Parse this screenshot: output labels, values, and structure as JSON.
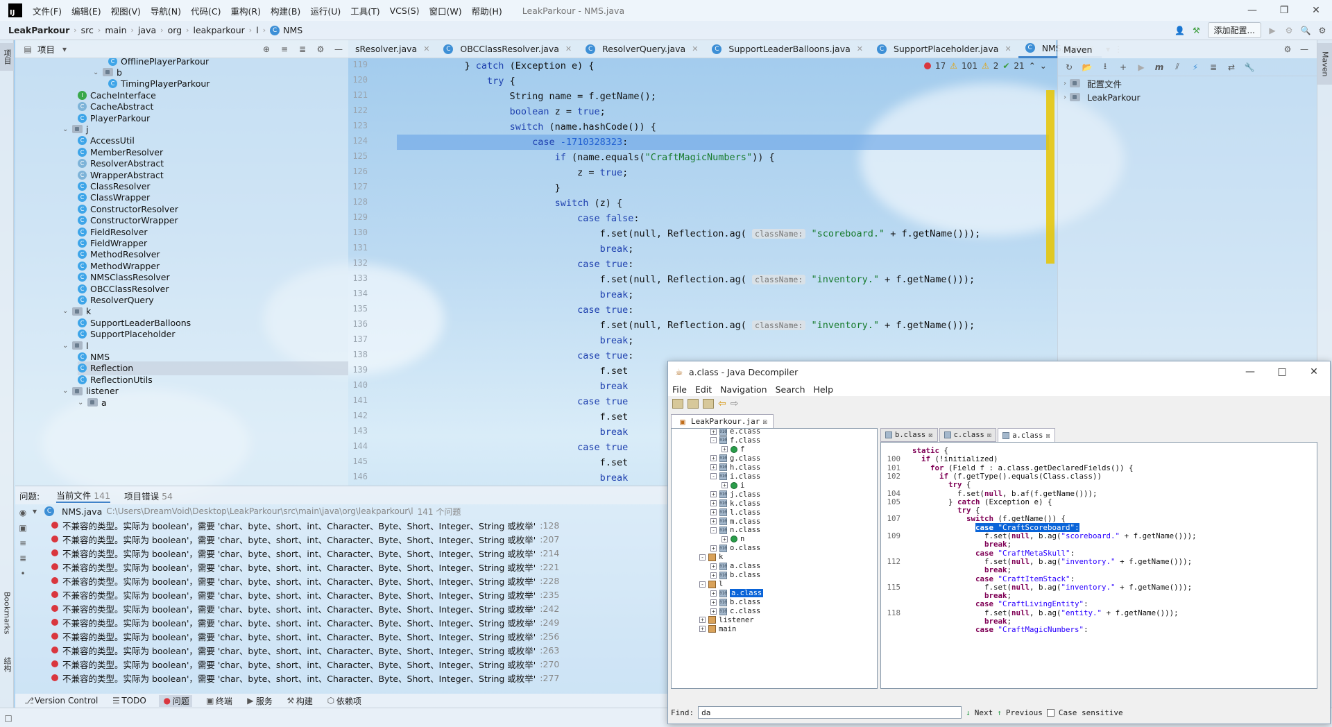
{
  "titlebar": {
    "menus": [
      "文件(F)",
      "编辑(E)",
      "视图(V)",
      "导航(N)",
      "代码(C)",
      "重构(R)",
      "构建(B)",
      "运行(U)",
      "工具(T)",
      "VCS(S)",
      "窗口(W)",
      "帮助(H)"
    ],
    "title": "LeakParkour - NMS.java"
  },
  "navbar": {
    "breadcrumbs": [
      "LeakParkour",
      "src",
      "main",
      "java",
      "org",
      "leakparkour",
      "l"
    ],
    "current": "NMS",
    "run_config": "添加配置..."
  },
  "left_stripe": {
    "project": "项目",
    "bookmarks": "Bookmarks",
    "structure": "结构"
  },
  "right_stripe": {
    "maven": "Maven"
  },
  "project_panel": {
    "title": "项目",
    "rows": [
      {
        "label": "OfflinePlayerParkour",
        "kind": "class"
      },
      {
        "label": "b",
        "kind": "package"
      },
      {
        "label": "TimingPlayerParkour",
        "kind": "class"
      },
      {
        "label": "CacheInterface",
        "kind": "interface"
      },
      {
        "label": "CacheAbstract",
        "kind": "abstract"
      },
      {
        "label": "PlayerParkour",
        "kind": "class"
      },
      {
        "label": "j",
        "kind": "package"
      },
      {
        "label": "AccessUtil",
        "kind": "class"
      },
      {
        "label": "MemberResolver",
        "kind": "class"
      },
      {
        "label": "ResolverAbstract",
        "kind": "abstract"
      },
      {
        "label": "WrapperAbstract",
        "kind": "abstract"
      },
      {
        "label": "ClassResolver",
        "kind": "class"
      },
      {
        "label": "ClassWrapper",
        "kind": "class"
      },
      {
        "label": "ConstructorResolver",
        "kind": "class"
      },
      {
        "label": "ConstructorWrapper",
        "kind": "class"
      },
      {
        "label": "FieldResolver",
        "kind": "class"
      },
      {
        "label": "FieldWrapper",
        "kind": "class"
      },
      {
        "label": "MethodResolver",
        "kind": "class"
      },
      {
        "label": "MethodWrapper",
        "kind": "class"
      },
      {
        "label": "NMSClassResolver",
        "kind": "class"
      },
      {
        "label": "OBCClassResolver",
        "kind": "class"
      },
      {
        "label": "ResolverQuery",
        "kind": "class"
      },
      {
        "label": "k",
        "kind": "package"
      },
      {
        "label": "SupportLeaderBalloons",
        "kind": "class"
      },
      {
        "label": "SupportPlaceholder",
        "kind": "class"
      },
      {
        "label": "l",
        "kind": "package"
      },
      {
        "label": "NMS",
        "kind": "class"
      },
      {
        "label": "Reflection",
        "kind": "class"
      },
      {
        "label": "ReflectionUtils",
        "kind": "class"
      },
      {
        "label": "listener",
        "kind": "package"
      },
      {
        "label": "a",
        "kind": "package"
      }
    ]
  },
  "editor": {
    "tabs": [
      "sResolver.java",
      "OBCClassResolver.java",
      "ResolverQuery.java",
      "SupportLeaderBalloons.java",
      "SupportPlaceholder.java",
      "NMS.java"
    ],
    "inspection": {
      "errors": "17",
      "warnings": "101",
      "weak": "2",
      "ok": "21"
    },
    "lines": [
      {
        "n": "119",
        "text": "            } catch (Exception e) {"
      },
      {
        "n": "120",
        "text": "                try {"
      },
      {
        "n": "121",
        "text": "                    String name = f.getName();"
      },
      {
        "n": "122",
        "text": "                    boolean z = true;"
      },
      {
        "n": "123",
        "text": "                    switch (name.hashCode()) {"
      },
      {
        "n": "124",
        "text": "                        case -1710328323:"
      },
      {
        "n": "125",
        "text": "                            if (name.equals(\"CraftMagicNumbers\")) {"
      },
      {
        "n": "126",
        "text": "                                z = true;"
      },
      {
        "n": "127",
        "text": "                            }"
      },
      {
        "n": "128",
        "text": "                            switch (z) {"
      },
      {
        "n": "129",
        "text": "                                case false:"
      },
      {
        "n": "130",
        "text": "                                    f.set(null, Reflection.ag( className: \"scoreboard.\" + f.getName()));"
      },
      {
        "n": "131",
        "text": "                                    break;"
      },
      {
        "n": "132",
        "text": "                                case true:"
      },
      {
        "n": "133",
        "text": "                                    f.set(null, Reflection.ag( className: \"inventory.\" + f.getName()));"
      },
      {
        "n": "134",
        "text": "                                    break;"
      },
      {
        "n": "135",
        "text": "                                case true:"
      },
      {
        "n": "136",
        "text": "                                    f.set(null, Reflection.ag( className: \"inventory.\" + f.getName()));"
      },
      {
        "n": "137",
        "text": "                                    break;"
      },
      {
        "n": "138",
        "text": "                                case true:"
      },
      {
        "n": "139",
        "text": "                                    f.set"
      },
      {
        "n": "140",
        "text": "                                    break"
      },
      {
        "n": "141",
        "text": "                                case true"
      },
      {
        "n": "142",
        "text": "                                    f.set"
      },
      {
        "n": "143",
        "text": "                                    break"
      },
      {
        "n": "144",
        "text": "                                case true"
      },
      {
        "n": "145",
        "text": "                                    f.set"
      },
      {
        "n": "146",
        "text": "                                    break"
      }
    ]
  },
  "maven": {
    "title": "Maven",
    "items": [
      "配置文件",
      "LeakParkour"
    ]
  },
  "problems": {
    "tabs": [
      {
        "label": "问题:",
        "count": ""
      },
      {
        "label": "当前文件",
        "count": "141"
      },
      {
        "label": "项目错误",
        "count": "54"
      }
    ],
    "file": {
      "name": "NMS.java",
      "path": "C:\\Users\\DreamVoid\\Desktop\\LeakParkour\\src\\main\\java\\org\\leakparkour\\l",
      "count": "141 个问题"
    },
    "rows": [
      {
        "msg": "不兼容的类型。实际为 boolean'，需要 'char、byte、short、int、Character、Byte、Short、Integer、String 或枚举'",
        "ln": ":128"
      },
      {
        "msg": "不兼容的类型。实际为 boolean'，需要 'char、byte、short、int、Character、Byte、Short、Integer、String 或枚举'",
        "ln": ":207"
      },
      {
        "msg": "不兼容的类型。实际为 boolean'，需要 'char、byte、short、int、Character、Byte、Short、Integer、String 或枚举'",
        "ln": ":214"
      },
      {
        "msg": "不兼容的类型。实际为 boolean'，需要 'char、byte、short、int、Character、Byte、Short、Integer、String 或枚举'",
        "ln": ":221"
      },
      {
        "msg": "不兼容的类型。实际为 boolean'，需要 'char、byte、short、int、Character、Byte、Short、Integer、String 或枚举'",
        "ln": ":228"
      },
      {
        "msg": "不兼容的类型。实际为 boolean'，需要 'char、byte、short、int、Character、Byte、Short、Integer、String 或枚举'",
        "ln": ":235"
      },
      {
        "msg": "不兼容的类型。实际为 boolean'，需要 'char、byte、short、int、Character、Byte、Short、Integer、String 或枚举'",
        "ln": ":242"
      },
      {
        "msg": "不兼容的类型。实际为 boolean'，需要 'char、byte、short、int、Character、Byte、Short、Integer、String 或枚举'",
        "ln": ":249"
      },
      {
        "msg": "不兼容的类型。实际为 boolean'，需要 'char、byte、short、int、Character、Byte、Short、Integer、String 或枚举'",
        "ln": ":256"
      },
      {
        "msg": "不兼容的类型。实际为 boolean'，需要 'char、byte、short、int、Character、Byte、Short、Integer、String 或枚举'",
        "ln": ":263"
      },
      {
        "msg": "不兼容的类型。实际为 boolean'，需要 'char、byte、short、int、Character、Byte、Short、Integer、String 或枚举'",
        "ln": ":270"
      },
      {
        "msg": "不兼容的类型。实际为 boolean'，需要 'char、byte、short、int、Character、Byte、Short、Integer、String 或枚举'",
        "ln": ":277"
      }
    ]
  },
  "bottombar": [
    "Version Control",
    "TODO",
    "问题",
    "终端",
    "服务",
    "构建",
    "依赖项"
  ],
  "decompiler": {
    "title": "a.class - Java Decompiler",
    "menus": [
      "File",
      "Edit",
      "Navigation",
      "Search",
      "Help"
    ],
    "file_tab": "LeakParkour.jar",
    "tree": [
      {
        "label": "e.class",
        "type": "class",
        "indent": 1,
        "pm": "+"
      },
      {
        "label": "f.class",
        "type": "class",
        "indent": 1,
        "pm": "-"
      },
      {
        "label": "f",
        "type": "method",
        "indent": 2,
        "pm": "+"
      },
      {
        "label": "g.class",
        "type": "class",
        "indent": 1,
        "pm": "+"
      },
      {
        "label": "h.class",
        "type": "class",
        "indent": 1,
        "pm": "+"
      },
      {
        "label": "i.class",
        "type": "class",
        "indent": 1,
        "pm": "-"
      },
      {
        "label": "i",
        "type": "method",
        "indent": 2,
        "pm": "+"
      },
      {
        "label": "j.class",
        "type": "class",
        "indent": 1,
        "pm": "+"
      },
      {
        "label": "k.class",
        "type": "class",
        "indent": 1,
        "pm": "+"
      },
      {
        "label": "l.class",
        "type": "class",
        "indent": 1,
        "pm": "+"
      },
      {
        "label": "m.class",
        "type": "class",
        "indent": 1,
        "pm": "+"
      },
      {
        "label": "n.class",
        "type": "class",
        "indent": 1,
        "pm": "-"
      },
      {
        "label": "n",
        "type": "method",
        "indent": 2,
        "pm": "+"
      },
      {
        "label": "o.class",
        "type": "class",
        "indent": 1,
        "pm": "+"
      },
      {
        "label": "k",
        "type": "package",
        "indent": 0,
        "pm": "-"
      },
      {
        "label": "a.class",
        "type": "class",
        "indent": 1,
        "pm": "+"
      },
      {
        "label": "b.class",
        "type": "class",
        "indent": 1,
        "pm": "+"
      },
      {
        "label": "l",
        "type": "package",
        "indent": 0,
        "pm": "-"
      },
      {
        "label": "a.class",
        "type": "class",
        "indent": 1,
        "pm": "+",
        "selected": true
      },
      {
        "label": "b.class",
        "type": "class",
        "indent": 1,
        "pm": "+"
      },
      {
        "label": "c.class",
        "type": "class",
        "indent": 1,
        "pm": "+"
      },
      {
        "label": "listener",
        "type": "package",
        "indent": 0,
        "pm": "+"
      },
      {
        "label": "main",
        "type": "package",
        "indent": 0,
        "pm": "+"
      }
    ],
    "code_tabs": [
      "b.class",
      "c.class",
      "a.class"
    ],
    "code": [
      {
        "n": "",
        "text": "  static {"
      },
      {
        "n": "100",
        "text": "    if (!initialized)"
      },
      {
        "n": "101",
        "text": "      for (Field f : a.class.getDeclaredFields()) {"
      },
      {
        "n": "102",
        "text": "        if (f.getType().equals(Class.class))"
      },
      {
        "n": "",
        "text": "          try {"
      },
      {
        "n": "104",
        "text": "            f.set(null, b.af(f.getName()));"
      },
      {
        "n": "105",
        "text": "          } catch (Exception e) {"
      },
      {
        "n": "",
        "text": "            try {"
      },
      {
        "n": "107",
        "text": "              switch (f.getName()) {"
      },
      {
        "n": "",
        "text": "                case \"CraftScoreboard\":",
        "hl": true
      },
      {
        "n": "109",
        "text": "                  f.set(null, b.ag(\"scoreboard.\" + f.getName()));"
      },
      {
        "n": "",
        "text": "                  break;"
      },
      {
        "n": "",
        "text": "                case \"CraftMetaSkull\":"
      },
      {
        "n": "112",
        "text": "                  f.set(null, b.ag(\"inventory.\" + f.getName()));"
      },
      {
        "n": "",
        "text": "                  break;"
      },
      {
        "n": "",
        "text": "                case \"CraftItemStack\":"
      },
      {
        "n": "115",
        "text": "                  f.set(null, b.ag(\"inventory.\" + f.getName()));"
      },
      {
        "n": "",
        "text": "                  break;"
      },
      {
        "n": "",
        "text": "                case \"CraftLivingEntity\":"
      },
      {
        "n": "118",
        "text": "                  f.set(null, b.ag(\"entity.\" + f.getName()));"
      },
      {
        "n": "",
        "text": "                  break;"
      },
      {
        "n": "",
        "text": "                case \"CraftMagicNumbers\":"
      }
    ],
    "find": {
      "label": "Find:",
      "value": "da",
      "next": "Next",
      "previous": "Previous",
      "case": "Case sensitive"
    }
  },
  "colors": {
    "accent": "#4083c9",
    "error": "#d9363e",
    "selection": "#0a64d8"
  }
}
